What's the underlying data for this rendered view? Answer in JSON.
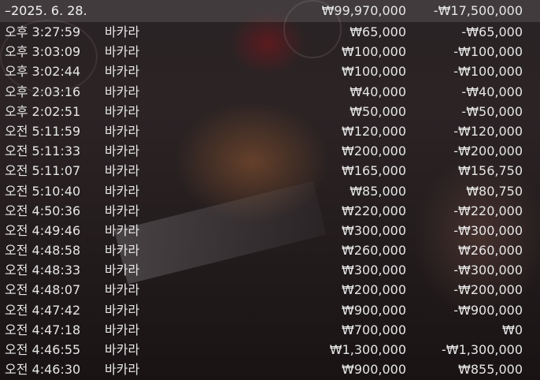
{
  "header": {
    "date": "–2025. 6. 28.",
    "total_bet": "₩99,970,000",
    "total_result": "-₩17,500,000"
  },
  "rows": [
    {
      "time": "오후 3:27:59",
      "game": "바카라",
      "bet": "₩65,000",
      "result": "-₩65,000"
    },
    {
      "time": "오후 3:03:09",
      "game": "바카라",
      "bet": "₩100,000",
      "result": "-₩100,000"
    },
    {
      "time": "오후 3:02:44",
      "game": "바카라",
      "bet": "₩100,000",
      "result": "-₩100,000"
    },
    {
      "time": "오후 2:03:16",
      "game": "바카라",
      "bet": "₩40,000",
      "result": "-₩40,000"
    },
    {
      "time": "오후 2:02:51",
      "game": "바카라",
      "bet": "₩50,000",
      "result": "-₩50,000"
    },
    {
      "time": "오전 5:11:59",
      "game": "바카라",
      "bet": "₩120,000",
      "result": "-₩120,000"
    },
    {
      "time": "오전 5:11:33",
      "game": "바카라",
      "bet": "₩200,000",
      "result": "-₩200,000"
    },
    {
      "time": "오전 5:11:07",
      "game": "바카라",
      "bet": "₩165,000",
      "result": "₩156,750"
    },
    {
      "time": "오전 5:10:40",
      "game": "바카라",
      "bet": "₩85,000",
      "result": "₩80,750"
    },
    {
      "time": "오전 4:50:36",
      "game": "바카라",
      "bet": "₩220,000",
      "result": "-₩220,000"
    },
    {
      "time": "오전 4:49:46",
      "game": "바카라",
      "bet": "₩300,000",
      "result": "-₩300,000"
    },
    {
      "time": "오전 4:48:58",
      "game": "바카라",
      "bet": "₩260,000",
      "result": "₩260,000"
    },
    {
      "time": "오전 4:48:33",
      "game": "바카라",
      "bet": "₩300,000",
      "result": "-₩300,000"
    },
    {
      "time": "오전 4:48:07",
      "game": "바카라",
      "bet": "₩200,000",
      "result": "-₩200,000"
    },
    {
      "time": "오전 4:47:42",
      "game": "바카라",
      "bet": "₩900,000",
      "result": "-₩900,000"
    },
    {
      "time": "오전 4:47:18",
      "game": "바카라",
      "bet": "₩700,000",
      "result": "₩0"
    },
    {
      "time": "오전 4:46:55",
      "game": "바카라",
      "bet": "₩1,300,000",
      "result": "-₩1,300,000"
    },
    {
      "time": "오전 4:46:30",
      "game": "바카라",
      "bet": "₩900,000",
      "result": "₩855,000"
    }
  ]
}
